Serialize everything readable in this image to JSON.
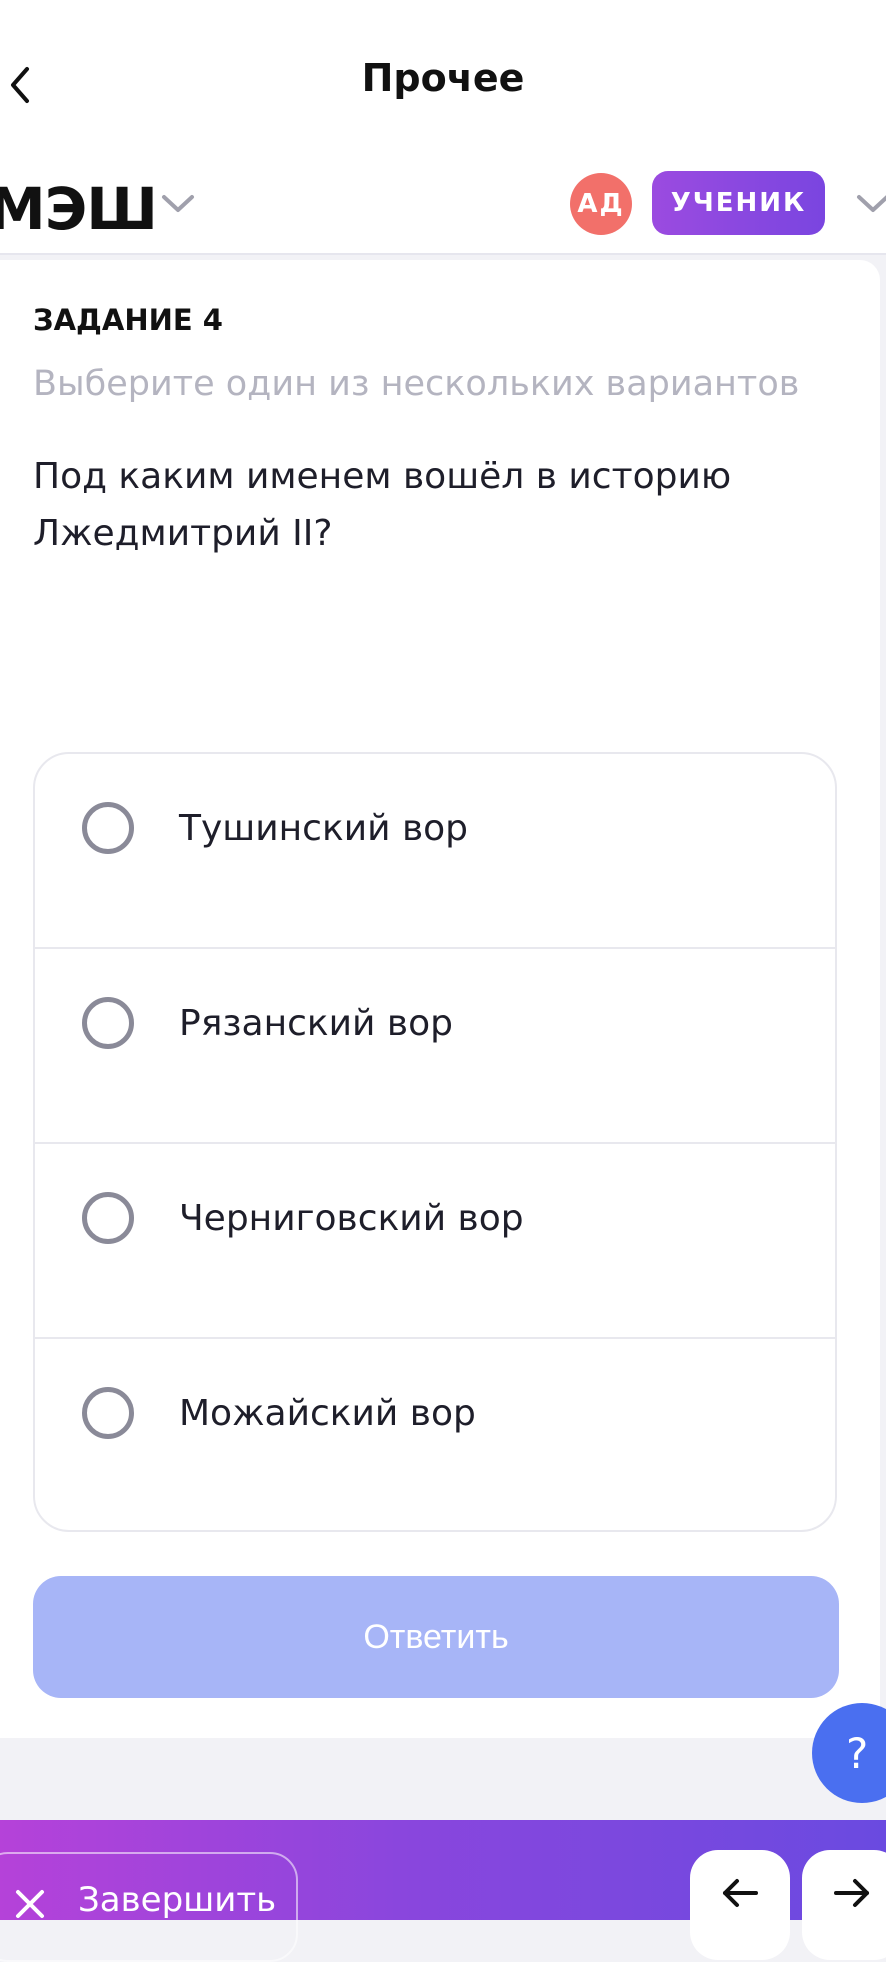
{
  "header": {
    "title": "Прочее",
    "back_icon": "chevron-left-icon"
  },
  "brand": {
    "logo_text": "МЭШ",
    "avatar_initials": "АД",
    "role_label": "УЧЕНИК",
    "colors": {
      "avatar": "#f2706a",
      "role": "#8a48e0"
    }
  },
  "task": {
    "label": "ЗАДАНИЕ 4",
    "hint": "Выберите один из нескольких вариантов",
    "question": "Под каким именем вошёл в историю Лжедмитрий II?",
    "options": [
      {
        "label": "Тушинский вор",
        "selected": false
      },
      {
        "label": "Рязанский вор",
        "selected": false
      },
      {
        "label": "Черниговский вор",
        "selected": false
      },
      {
        "label": "Можайский вор",
        "selected": false
      }
    ],
    "answer_label": "Ответить"
  },
  "help": {
    "label": "?"
  },
  "footer": {
    "finish_label": "Завершить",
    "prev_icon": "arrow-left-icon",
    "next_icon": "arrow-right-icon"
  }
}
